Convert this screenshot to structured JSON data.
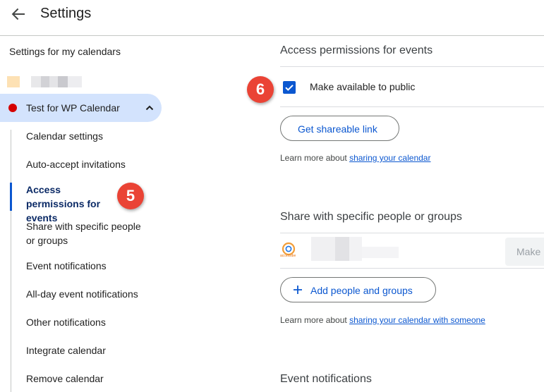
{
  "header": {
    "title": "Settings",
    "back_icon": "arrow-back-icon"
  },
  "sidebar": {
    "heading": "Settings for my calendars",
    "calendar": {
      "name": "Test for WP Calendar",
      "color": "#d50000",
      "expand_icon": "chevron-up-icon"
    },
    "items": [
      {
        "label": "Calendar settings"
      },
      {
        "label": "Auto-accept invitations"
      },
      {
        "label": "Access permissions for events"
      },
      {
        "label": "Share with specific people or groups"
      },
      {
        "label": "Event notifications"
      },
      {
        "label": "All-day event notifications"
      },
      {
        "label": "Other notifications"
      },
      {
        "label": "Integrate calendar"
      },
      {
        "label": "Remove calendar"
      }
    ],
    "active_index": 2
  },
  "main": {
    "access": {
      "title": "Access permissions for events",
      "public_checkbox": {
        "label": "Make available to public",
        "checked": true
      },
      "shareable_button": "Get shareable link",
      "learn_prefix": "Learn more about ",
      "learn_link": "sharing your calendar"
    },
    "share": {
      "title": "Share with specific people or groups",
      "avatar_logo_text": "accessibe",
      "permission_partial": "Make",
      "add_button": "Add people and groups",
      "add_icon": "plus-icon",
      "learn_prefix": "Learn more about ",
      "learn_link": "sharing your calendar with someone"
    },
    "event_notifications": {
      "title": "Event notifications"
    }
  },
  "callouts": {
    "sidebar_step": "5",
    "checkbox_step": "6"
  },
  "colors": {
    "accent": "#0b57d0",
    "selected_bg": "#d3e3fd",
    "callout": "#ea4335",
    "calendar": "#d50000"
  }
}
